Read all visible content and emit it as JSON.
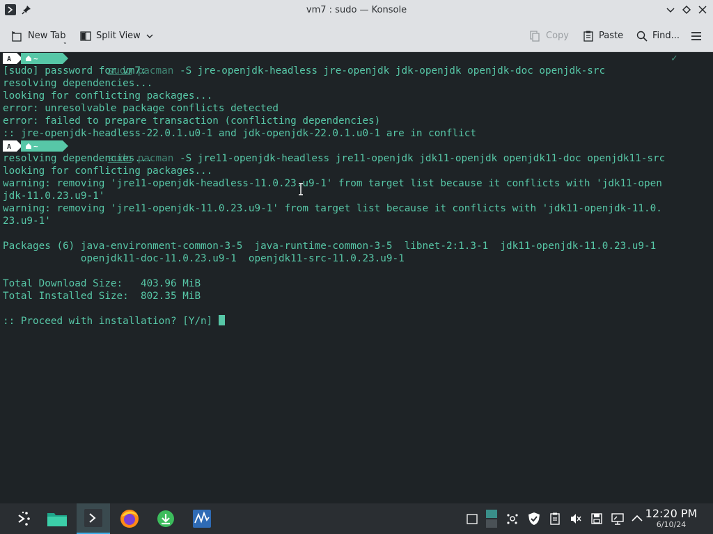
{
  "window": {
    "title": "vm7 : sudo — Konsole"
  },
  "toolbar": {
    "new_tab": "New Tab",
    "split_view": "Split View",
    "copy": "Copy",
    "paste": "Paste",
    "find": "Find..."
  },
  "prompt": {
    "dir": "~"
  },
  "terminal": {
    "cmd1_sudo": "sudo",
    "cmd1_pacman": "pacman",
    "cmd1_args": " -S jre-openjdk-headless jre-openjdk jdk-openjdk openjdk-doc openjdk-src",
    "l2": "[sudo] password for vm7:",
    "l3": "resolving dependencies...",
    "l4": "looking for conflicting packages...",
    "l5": "error: unresolvable package conflicts detected",
    "l6": "error: failed to prepare transaction (conflicting dependencies)",
    "l7": ":: jre-openjdk-headless-22.0.1.u0-1 and jdk-openjdk-22.0.1.u0-1 are in conflict",
    "cmd2_sudo": "sudo",
    "cmd2_pacman": "pacman",
    "cmd2_args": " -S jre11-openjdk-headless jre11-openjdk jdk11-openjdk openjdk11-doc openjdk11-src",
    "l9": "resolving dependencies...",
    "l10": "looking for conflicting packages...",
    "l11": "warning: removing 'jre11-openjdk-headless-11.0.23.u9-1' from target list because it conflicts with 'jdk11-open",
    "l12": "jdk-11.0.23.u9-1'",
    "l13": "warning: removing 'jre11-openjdk-11.0.23.u9-1' from target list because it conflicts with 'jdk11-openjdk-11.0.",
    "l14": "23.u9-1'",
    "l16": "Packages (6) java-environment-common-3-5  java-runtime-common-3-5  libnet-2:1.3-1  jdk11-openjdk-11.0.23.u9-1",
    "l17": "             openjdk11-doc-11.0.23.u9-1  openjdk11-src-11.0.23.u9-1",
    "l19": "Total Download Size:   403.96 MiB",
    "l20": "Total Installed Size:  802.35 MiB",
    "l22": ":: Proceed with installation? [Y/n] ",
    "check_mark": "✓"
  },
  "taskbar": {
    "time": "12:20 PM",
    "date": "6/10/24"
  },
  "colors": {
    "terminal_bg": "#1e2326",
    "terminal_fg": "#57c7a7",
    "chrome_bg": "#dfe1e4",
    "taskbar_bg": "#2a2e32",
    "accent": "#3daee9"
  }
}
